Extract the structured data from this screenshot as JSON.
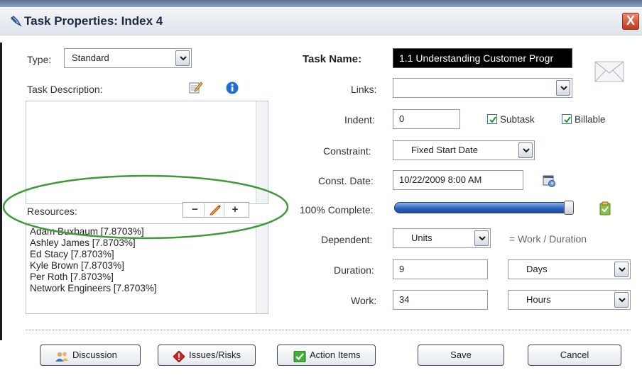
{
  "window": {
    "title": "Task Properties: Index 4",
    "close_label": "X"
  },
  "left": {
    "type_label": "Type:",
    "type_value": "Standard",
    "description_label": "Task Description:",
    "description_text": "",
    "resources_label": "Resources:",
    "resources": [
      "Adam Buxbaum [7.8703%]",
      "Ashley James [7.8703%]",
      "Ed Stacy [7.8703%]",
      "Kyle Brown [7.8703%]",
      "Per Roth [7.8703%]",
      "Network Engineers [7.8703%]"
    ],
    "resource_tools": {
      "remove": "−",
      "add": "+"
    }
  },
  "right": {
    "task_name_label": "Task Name:",
    "task_name_value": "1.1 Understanding Customer Progr",
    "links_label": "Links:",
    "links_value": "",
    "indent_label": "Indent:",
    "indent_value": "0",
    "subtask_label": "Subtask",
    "subtask_checked": true,
    "billable_label": "Billable",
    "billable_checked": true,
    "constraint_label": "Constraint:",
    "constraint_value": "Fixed Start Date",
    "const_date_label": "Const. Date:",
    "const_date_value": "10/22/2009 8:00 AM",
    "percent_complete_label": "100% Complete:",
    "percent_complete": 1.0,
    "dependent_label": "Dependent:",
    "dependent_value": "Units",
    "dependent_formula": "= Work / Duration",
    "duration_label": "Duration:",
    "duration_value": "9",
    "duration_unit": "Days",
    "work_label": "Work:",
    "work_value": "34",
    "work_unit": "Hours"
  },
  "buttons": {
    "discussion": "Discussion",
    "issues_risks": "Issues/Risks",
    "action_items": "Action Items",
    "save": "Save",
    "cancel": "Cancel"
  },
  "colors": {
    "task_name_bg": "#000000",
    "slider": "#2f63bf",
    "highlight_ellipse": "#3f9a3a",
    "info_icon": "#1f6fd0",
    "issues_icon": "#d32222",
    "action_icon": "#3fae3a"
  },
  "icons": [
    "pin-icon",
    "close-icon",
    "edit-note-icon",
    "info-icon",
    "envelope-icon",
    "calendar-icon",
    "notes-icon",
    "people-icon",
    "warning-icon",
    "checkmark-icon",
    "pencil-icon"
  ]
}
